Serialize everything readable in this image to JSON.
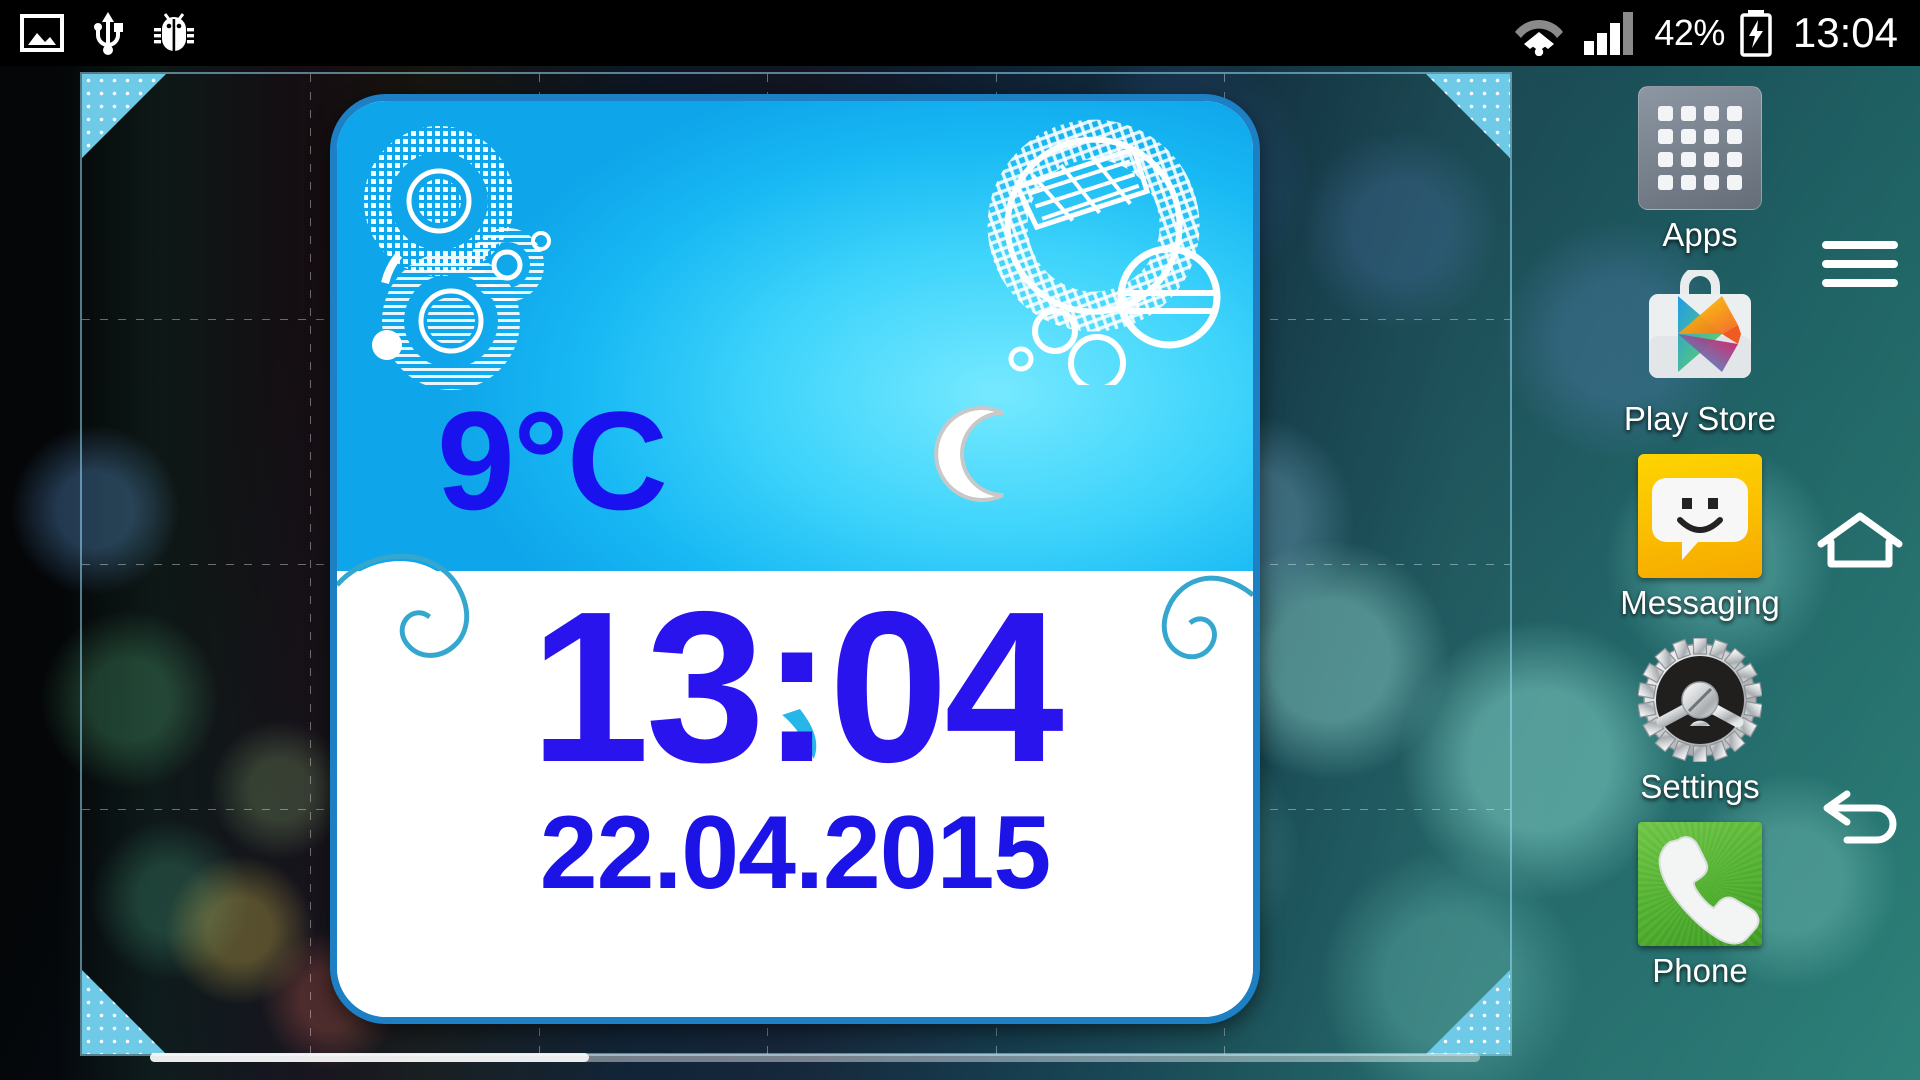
{
  "status_bar": {
    "left_icons": [
      {
        "name": "screenshot-icon",
        "label": "Screenshot"
      },
      {
        "name": "usb-icon",
        "label": "USB connected"
      },
      {
        "name": "usb-debug-icon",
        "label": "USB debugging"
      }
    ],
    "wifi_icon": "wifi-icon",
    "signal_icon": "cellular-signal-icon",
    "signal_bars_filled": 3,
    "signal_bars_total": 4,
    "battery_percent": "42%",
    "battery_icon": "battery-charging-icon",
    "clock": "13:04"
  },
  "widget": {
    "name": "weather-clock-widget",
    "temperature": "9°C",
    "weather_icon": "crescent-moon-icon",
    "time": "13:04",
    "date": "22.04.2015",
    "accent_border": "#1d7fc4",
    "top_color": "#3fd4fb",
    "text_color": "#2a14ed"
  },
  "app_column": {
    "items": [
      {
        "label": "Apps",
        "icon": "apps-grid-icon",
        "name": "app-icon-apps"
      },
      {
        "label": "Play Store",
        "icon": "play-store-icon",
        "name": "app-icon-play-store"
      },
      {
        "label": "Messaging",
        "icon": "messaging-icon",
        "name": "app-icon-messaging"
      },
      {
        "label": "Settings",
        "icon": "settings-gear-icon",
        "name": "app-icon-settings"
      },
      {
        "label": "Phone",
        "icon": "phone-handset-icon",
        "name": "app-icon-phone"
      }
    ]
  },
  "nav_bar": {
    "buttons": [
      {
        "name": "menu-icon",
        "label": "Menu"
      },
      {
        "name": "home-icon",
        "label": "Home"
      },
      {
        "name": "back-icon",
        "label": "Back"
      }
    ]
  },
  "page_indicator": {
    "name": "home-page-indicator",
    "position": "1",
    "total": "3"
  }
}
